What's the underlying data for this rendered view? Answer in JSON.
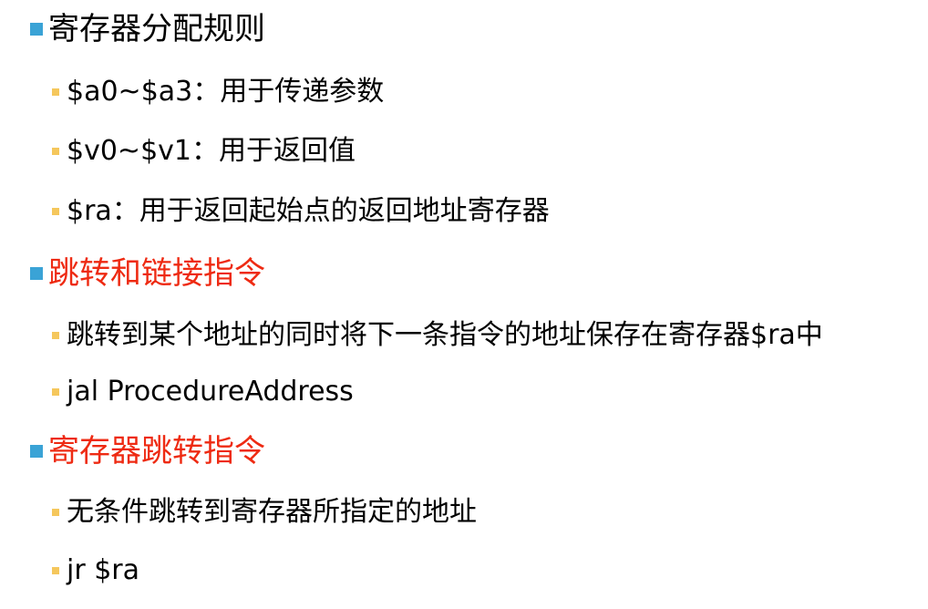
{
  "colors": {
    "level1_bullet": "#3aa3d6",
    "level2_bullet": "#f5c75c",
    "highlight_text": "#ee2a12",
    "text": "#000000"
  },
  "sections": [
    {
      "heading": "寄存器分配规则",
      "items": [
        "$a0~$a3：用于传递参数",
        "$v0~$v1：用于返回值",
        "$ra：用于返回起始点的返回地址寄存器"
      ]
    },
    {
      "heading": "跳转和链接指令",
      "items": [
        "跳转到某个地址的同时将下一条指令的地址保存在寄存器$ra中",
        "jal ProcedureAddress"
      ]
    },
    {
      "heading": "寄存器跳转指令",
      "items": [
        "无条件跳转到寄存器所指定的地址",
        "jr $ra"
      ]
    }
  ]
}
